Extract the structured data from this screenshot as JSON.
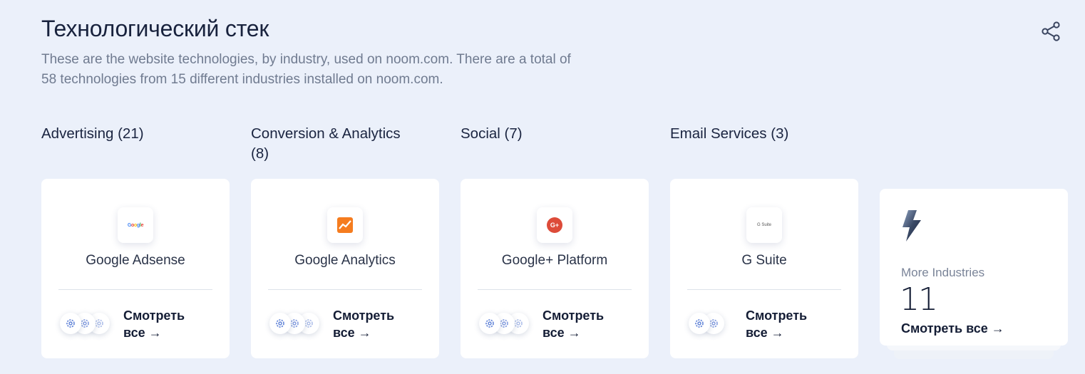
{
  "section": {
    "title": "Технологический стек",
    "description": "These are the website technologies, by industry, used on noom.com. There are a total of 58 technologies from 15 different industries installed on noom.com."
  },
  "icons": {
    "share": "share-icon",
    "gear": "gear-icon",
    "arrow": "arrow-right-icon",
    "bolt": "lightning-bolt-icon"
  },
  "categories": [
    {
      "title": "Advertising (21)",
      "tech": "Google Adsense",
      "logo_text": "Google",
      "see_all": "Смотреть все",
      "gear_count": 3
    },
    {
      "title": "Conversion & Analytics (8)",
      "tech": "Google Analytics",
      "logo_text": "",
      "see_all": "Смотреть все",
      "gear_count": 3
    },
    {
      "title": "Social (7)",
      "tech": "Google+ Platform",
      "logo_text": "G+",
      "see_all": "Смотреть все",
      "gear_count": 3
    },
    {
      "title": "Email Services (3)",
      "tech": "G Suite",
      "logo_text": "G Suite",
      "see_all": "Смотреть все",
      "gear_count": 2
    }
  ],
  "more": {
    "label": "More Industries",
    "count": "11",
    "see_all": "Смотреть все"
  },
  "colors": {
    "background": "#ebf0fa",
    "gear": "#5b7fd6",
    "analytics_orange": "#f57c1f",
    "gplus_red": "#dd4b39"
  }
}
